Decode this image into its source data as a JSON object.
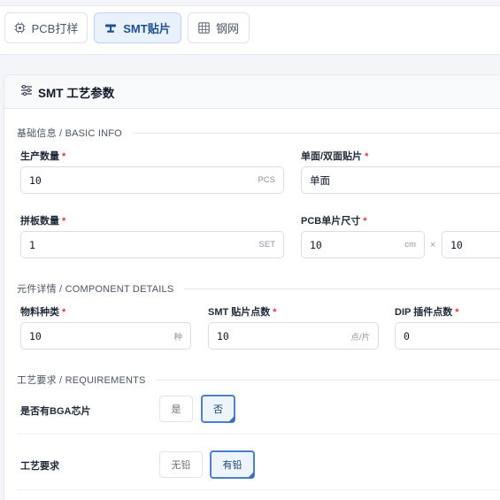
{
  "tabs": [
    {
      "label": "PCB打样",
      "icon": "chip-icon",
      "active": false
    },
    {
      "label": "SMT贴片",
      "icon": "smt-icon",
      "active": true
    },
    {
      "label": "钢网",
      "icon": "grid-icon",
      "active": false
    }
  ],
  "card": {
    "icon": "sliders-icon",
    "title": "SMT 工艺参数"
  },
  "sections": {
    "basic": "基础信息 / BASIC INFO",
    "component": "元件详情 / COMPONENT DETAILS",
    "requirements": "工艺要求 / REQUIREMENTS"
  },
  "basic": {
    "quantity": {
      "label": "生产数量",
      "required": "*",
      "value": "10",
      "unit": "PCS"
    },
    "side": {
      "label": "单面/双面贴片",
      "required": "*",
      "value": "单面"
    },
    "panel": {
      "label": "拼板数量",
      "required": "*",
      "value": "1",
      "unit": "SET"
    },
    "size": {
      "label": "PCB单片尺寸",
      "required": "*",
      "width": "10",
      "height": "10",
      "unit": "cm",
      "separator": "×"
    }
  },
  "component": {
    "types": {
      "label": "物料种类",
      "required": "*",
      "value": "10",
      "unit": "种"
    },
    "smt_points": {
      "label": "SMT 贴片点数",
      "required": "*",
      "value": "10",
      "unit": "点/片"
    },
    "dip_points": {
      "label": "DIP 插件点数",
      "required": "*",
      "value": "0"
    }
  },
  "requirements": {
    "bga": {
      "label": "是否有BGA芯片",
      "options": [
        "是",
        "否"
      ],
      "selected": "否"
    },
    "process": {
      "label": "工艺要求",
      "options": [
        "无铅",
        "有铅"
      ],
      "selected": "有铅"
    }
  },
  "colors": {
    "accent": "#4a7fd1",
    "required": "#e0334a"
  }
}
